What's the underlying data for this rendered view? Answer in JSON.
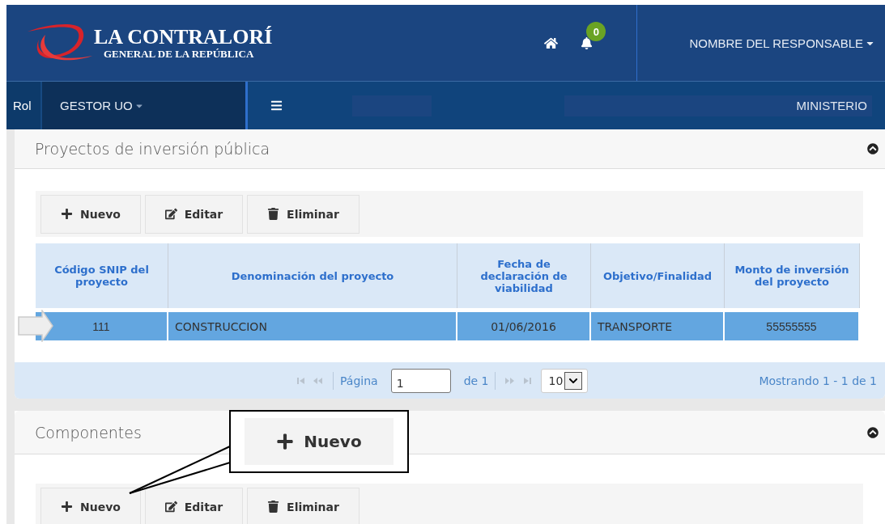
{
  "header": {
    "logo": {
      "title": "LA CONTRALORÍ",
      "subtitle": "GENERAL DE LA REPÚBLICA"
    },
    "notifications": "0",
    "user": "NOMBRE DEL RESPONSABLE"
  },
  "nav": {
    "role_label": "Rol",
    "role": "GESTOR UO",
    "entity": "MINISTERIO"
  },
  "panels": [
    {
      "title": "Proyectos de inversión pública",
      "toolbar": [
        {
          "kind": "new",
          "label": "Nuevo"
        },
        {
          "kind": "edit",
          "label": "Editar"
        },
        {
          "kind": "delete",
          "label": "Eliminar"
        }
      ],
      "table": {
        "columns": [
          "Código SNIP del proyecto",
          "Denominación del proyecto",
          "Fecha de declaración de viabilidad",
          "Objetivo/Finalidad",
          "Monto de inversión del proyecto"
        ],
        "rows": [
          {
            "selected": true,
            "cells": [
              "111",
              "CONSTRUCCION",
              "01/06/2016",
              "TRANSPORTE",
              "55555555"
            ]
          }
        ]
      },
      "pager": {
        "page_label": "Página",
        "page": "1",
        "of": "de 1",
        "page_size": "10",
        "summary": "Mostrando 1 - 1 de 1"
      }
    },
    {
      "title": "Componentes",
      "toolbar": [
        {
          "kind": "new",
          "label": "Nuevo"
        },
        {
          "kind": "edit",
          "label": "Editar"
        },
        {
          "kind": "delete",
          "label": "Eliminar"
        }
      ]
    }
  ],
  "callout": {
    "kind": "new",
    "label": "Nuevo"
  }
}
